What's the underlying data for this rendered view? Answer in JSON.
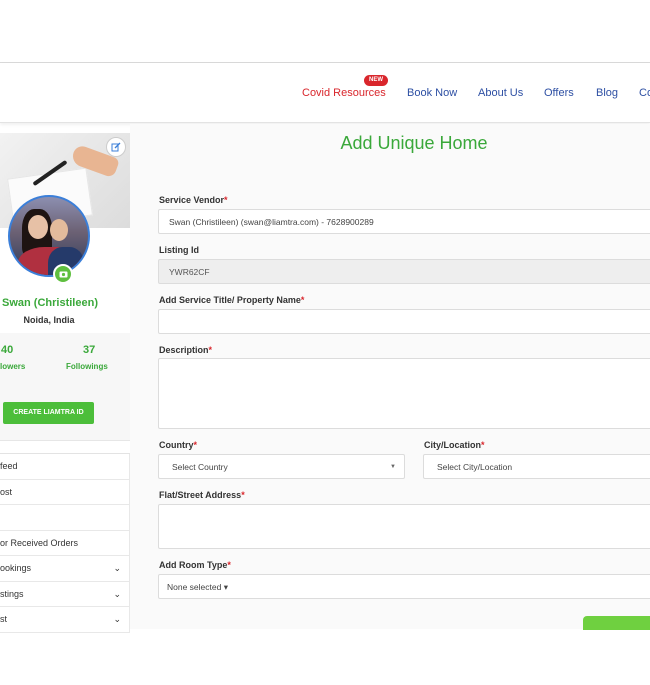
{
  "nav": {
    "items": [
      "Covid Resources",
      "Book Now",
      "About Us",
      "Offers",
      "Blog",
      "Co"
    ],
    "new_badge": "NEW"
  },
  "sidebar": {
    "profile_name": "Swan (Christileen)",
    "location": "Noida, India",
    "followers_count": "40",
    "followers_label": "lowers",
    "followings_count": "37",
    "followings_label": "Followings",
    "create_button": "CREATE LIAMTRA ID",
    "menu": [
      {
        "label": "feed",
        "chevron": ""
      },
      {
        "label": "ost",
        "chevron": ""
      },
      {
        "label": "",
        "chevron": ""
      },
      {
        "label": "or Received Orders",
        "chevron": ""
      },
      {
        "label": "ookings",
        "chevron": "⌄"
      },
      {
        "label": "stings",
        "chevron": "⌄"
      },
      {
        "label": "st",
        "chevron": "⌄"
      }
    ]
  },
  "main": {
    "title": "Add Unique Home",
    "service_vendor": {
      "label": "Service Vendor",
      "value": "Swan (Christileen) (swan@liamtra.com) - 7628900289"
    },
    "listing_id": {
      "label": "Listing Id",
      "value": "YWR62CF"
    },
    "service_title": {
      "label": "Add Service Title/ Property Name",
      "value": ""
    },
    "description": {
      "label": "Description",
      "value": ""
    },
    "country": {
      "label": "Country",
      "value": "Select Country"
    },
    "city": {
      "label": "City/Location",
      "value": "Select City/Location"
    },
    "address": {
      "label": "Flat/Street Address",
      "value": ""
    },
    "room_type": {
      "label": "Add Room Type",
      "value": "None selected ▾"
    },
    "required_mark": "*"
  },
  "colors": {
    "brand_green": "#3aa83a",
    "nav_blue": "#2d4fa3",
    "covid_red": "#d9262c"
  }
}
